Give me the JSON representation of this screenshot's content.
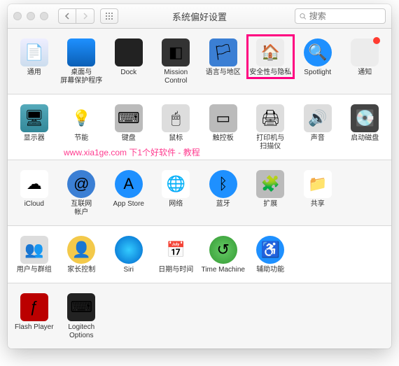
{
  "window_title": "系统偏好设置",
  "search_placeholder": "搜索",
  "watermark": "www.xia1ge.com  下1个好软件 - 教程",
  "rows": [
    {
      "alt": false,
      "items": [
        {
          "key": "general",
          "label": "通用",
          "icon": "ic-general",
          "glyph": "📄"
        },
        {
          "key": "desktop",
          "label": "桌面与\n屏幕保护程序",
          "icon": "ic-desktop",
          "glyph": ""
        },
        {
          "key": "dock",
          "label": "Dock",
          "icon": "ic-dock",
          "glyph": ""
        },
        {
          "key": "mission",
          "label": "Mission\nControl",
          "icon": "ic-mission",
          "glyph": "◧"
        },
        {
          "key": "language",
          "label": "语言与地区",
          "icon": "ic-language",
          "glyph": "🏳"
        },
        {
          "key": "security",
          "label": "安全性与隐私",
          "icon": "ic-security",
          "glyph": "🏠",
          "highlighted": true
        },
        {
          "key": "spotlight",
          "label": "Spotlight",
          "icon": "ic-spotlight",
          "glyph": "🔍"
        },
        {
          "key": "notifications",
          "label": "通知",
          "icon": "ic-notif",
          "glyph": "",
          "badge": true
        }
      ]
    },
    {
      "alt": true,
      "items": [
        {
          "key": "displays",
          "label": "显示器",
          "icon": "ic-display",
          "glyph": "🖥"
        },
        {
          "key": "energy",
          "label": "节能",
          "icon": "ic-energy",
          "glyph": "💡"
        },
        {
          "key": "keyboard",
          "label": "键盘",
          "icon": "ic-keyboard",
          "glyph": "⌨"
        },
        {
          "key": "mouse",
          "label": "鼠标",
          "icon": "ic-mouse",
          "glyph": "🖱"
        },
        {
          "key": "trackpad",
          "label": "触控板",
          "icon": "ic-trackpad",
          "glyph": "▭"
        },
        {
          "key": "printers",
          "label": "打印机与\n扫描仪",
          "icon": "ic-printer",
          "glyph": "🖨"
        },
        {
          "key": "sound",
          "label": "声音",
          "icon": "ic-sound",
          "glyph": "🔊"
        },
        {
          "key": "startup",
          "label": "启动磁盘",
          "icon": "ic-startup",
          "glyph": "💽"
        }
      ]
    },
    {
      "alt": false,
      "items": [
        {
          "key": "icloud",
          "label": "iCloud",
          "icon": "ic-icloud",
          "glyph": "☁"
        },
        {
          "key": "internet",
          "label": "互联网\n帐户",
          "icon": "ic-internet",
          "glyph": "@"
        },
        {
          "key": "appstore",
          "label": "App Store",
          "icon": "ic-appstore",
          "glyph": "A"
        },
        {
          "key": "network",
          "label": "网络",
          "icon": "ic-network",
          "glyph": "🌐"
        },
        {
          "key": "bluetooth",
          "label": "蓝牙",
          "icon": "ic-bluetooth",
          "glyph": "ᛒ"
        },
        {
          "key": "extensions",
          "label": "扩展",
          "icon": "ic-ext",
          "glyph": "🧩"
        },
        {
          "key": "sharing",
          "label": "共享",
          "icon": "ic-share",
          "glyph": "📁"
        }
      ]
    },
    {
      "alt": true,
      "items": [
        {
          "key": "users",
          "label": "用户与群组",
          "icon": "ic-users",
          "glyph": "👥"
        },
        {
          "key": "parental",
          "label": "家长控制",
          "icon": "ic-parental",
          "glyph": "👤"
        },
        {
          "key": "siri",
          "label": "Siri",
          "icon": "ic-siri",
          "glyph": ""
        },
        {
          "key": "datetime",
          "label": "日期与时间",
          "icon": "ic-datetime",
          "glyph": "📅"
        },
        {
          "key": "timemachine",
          "label": "Time Machine",
          "icon": "ic-timemachine",
          "glyph": "↺"
        },
        {
          "key": "accessibility",
          "label": "辅助功能",
          "icon": "ic-accessibility",
          "glyph": "♿"
        }
      ]
    },
    {
      "alt": false,
      "items": [
        {
          "key": "flash",
          "label": "Flash Player",
          "icon": "ic-flash",
          "glyph": "ƒ"
        },
        {
          "key": "logitech",
          "label": "Logitech Options",
          "icon": "ic-logitech",
          "glyph": "⌨"
        }
      ]
    }
  ]
}
